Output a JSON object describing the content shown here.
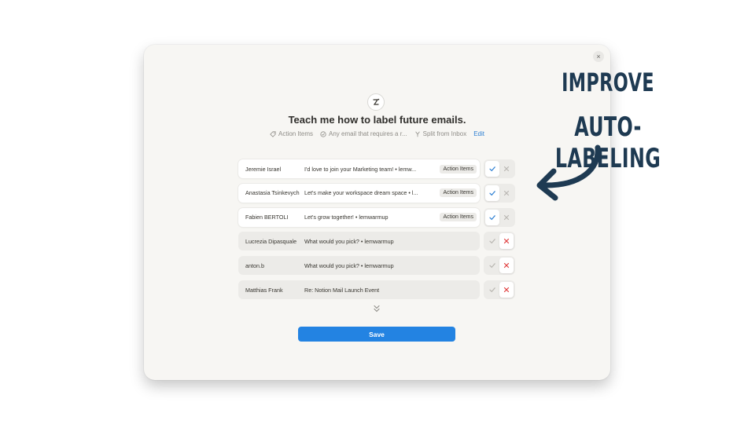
{
  "modal": {
    "close_label": "×",
    "title": "Teach me how to label future emails.",
    "criteria": [
      {
        "icon": "tag-icon",
        "label": "Action Items"
      },
      {
        "icon": "sparkle-check-icon",
        "label": "Any email that requires a r..."
      },
      {
        "icon": "split-icon",
        "label": "Split from Inbox"
      }
    ],
    "edit_label": "Edit",
    "emails": [
      {
        "sender": "Jeremie Israel",
        "subject": "I'd love to join your Marketing team! • lemw...",
        "label": "Action Items",
        "state": "approved"
      },
      {
        "sender": "Anastasia Tsinkevych",
        "subject": "Let's make your workspace dream space • l...",
        "label": "Action Items",
        "state": "approved"
      },
      {
        "sender": "Fabien BERTOLI",
        "subject": "Let's grow together! • lemwarmup",
        "label": "Action Items",
        "state": "approved"
      },
      {
        "sender": "Lucrezia Dipasquale",
        "subject": "What would you pick? • lemwarmup",
        "label": "",
        "state": "rejected"
      },
      {
        "sender": "anton.b",
        "subject": "What would you pick? • lemwarmup",
        "label": "",
        "state": "rejected"
      },
      {
        "sender": "Matthias Frank",
        "subject": "Re: Notion Mail Launch Event",
        "label": "",
        "state": "rejected"
      }
    ],
    "save_label": "Save"
  },
  "overlay": {
    "line1": "IMPROVE",
    "line2": "AUTO-LABELING",
    "color": "#1e3a52"
  },
  "colors": {
    "accent": "#2383e2",
    "approve": "#2f80d3",
    "reject": "#e03e3e"
  }
}
